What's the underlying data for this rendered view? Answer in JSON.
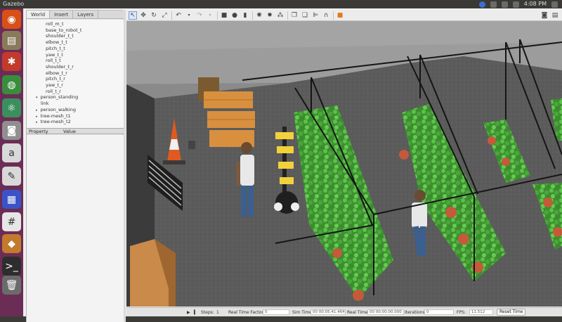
{
  "system_bar": {
    "title": "Gazebo",
    "time": "4:08 PM",
    "icons": [
      "dropbox-icon",
      "wifi-icon",
      "mail-icon",
      "volume-icon",
      "clock-icon",
      "gear-icon"
    ]
  },
  "launcher": {
    "items": [
      {
        "name": "ubuntu-icon",
        "bg": "#d94f16",
        "glyph": "◉"
      },
      {
        "name": "files-icon",
        "bg": "#8a7a5c",
        "glyph": "▤"
      },
      {
        "name": "system-settings-icon",
        "bg": "#c33a2c",
        "glyph": "✱"
      },
      {
        "name": "chrome-icon",
        "bg": "#3a8d3d",
        "glyph": "◍"
      },
      {
        "name": "atom-icon",
        "bg": "#3b8f5d",
        "glyph": "⚛"
      },
      {
        "name": "camera-icon",
        "bg": "#8f8f8f",
        "glyph": "◙"
      },
      {
        "name": "amazon-icon",
        "bg": "#d9d9d9",
        "glyph": "a"
      },
      {
        "name": "text-editor-icon",
        "bg": "#d8d8d8",
        "glyph": "✎"
      },
      {
        "name": "calculator-icon",
        "bg": "#3b53c8",
        "glyph": "▦"
      },
      {
        "name": "slack-icon",
        "bg": "#e6e6e6",
        "glyph": "#"
      },
      {
        "name": "gazebo-icon",
        "bg": "#c27a2c",
        "glyph": "◆"
      },
      {
        "name": "terminal-icon",
        "bg": "#2d2d2d",
        "glyph": ">_"
      },
      {
        "name": "trash-icon",
        "bg": "#6b6b6b",
        "glyph": "🗑"
      }
    ]
  },
  "left_panel": {
    "tabs": [
      "World",
      "Insert",
      "Layers"
    ],
    "active_tab": "World",
    "tree": [
      {
        "label": "roll_m_t",
        "indent": 3,
        "arrow": ""
      },
      {
        "label": "base_to_robot_t",
        "indent": 3,
        "arrow": ""
      },
      {
        "label": "shoulder_t_t",
        "indent": 3,
        "arrow": ""
      },
      {
        "label": "elbow_t_t",
        "indent": 3,
        "arrow": ""
      },
      {
        "label": "pitch_t_t",
        "indent": 3,
        "arrow": ""
      },
      {
        "label": "yaw_t_t",
        "indent": 3,
        "arrow": ""
      },
      {
        "label": "roll_t_t",
        "indent": 3,
        "arrow": ""
      },
      {
        "label": "shoulder_t_r",
        "indent": 3,
        "arrow": ""
      },
      {
        "label": "elbow_t_r",
        "indent": 3,
        "arrow": ""
      },
      {
        "label": "pitch_t_r",
        "indent": 3,
        "arrow": ""
      },
      {
        "label": "yaw_t_r",
        "indent": 3,
        "arrow": ""
      },
      {
        "label": "roll_t_r",
        "indent": 3,
        "arrow": ""
      },
      {
        "label": "person_standing",
        "indent": 1,
        "arrow": "▾"
      },
      {
        "label": "link",
        "indent": 2,
        "arrow": ""
      },
      {
        "label": "person_walking",
        "indent": 1,
        "arrow": "▸"
      },
      {
        "label": "tree-mesh_t1",
        "indent": 1,
        "arrow": "▸"
      },
      {
        "label": "tree-mesh_t2",
        "indent": 1,
        "arrow": "▸"
      }
    ],
    "property_header": "Property",
    "value_header": "Value"
  },
  "bottom_bar": {
    "steps_label": "Steps:",
    "steps_value": "1",
    "rtf_label": "Real Time Factor:",
    "rtf_value": "0",
    "sim_time_label": "Sim Time:",
    "sim_time_value": "00 00:05:41.464",
    "real_time_label": "Real Time:",
    "real_time_value": "00 00:00:00.000",
    "iterations_label": "Iterations:",
    "iterations_value": "0",
    "fps_label": "FPS:",
    "fps_value": "11.512",
    "reset_label": "Reset Time"
  },
  "colors": {
    "launcher_bg": "#6b2d55",
    "ground": "#5e5e5e",
    "wall": "#9a9a9a",
    "plant": "#4caa3c",
    "pot": "#c55a3a"
  }
}
